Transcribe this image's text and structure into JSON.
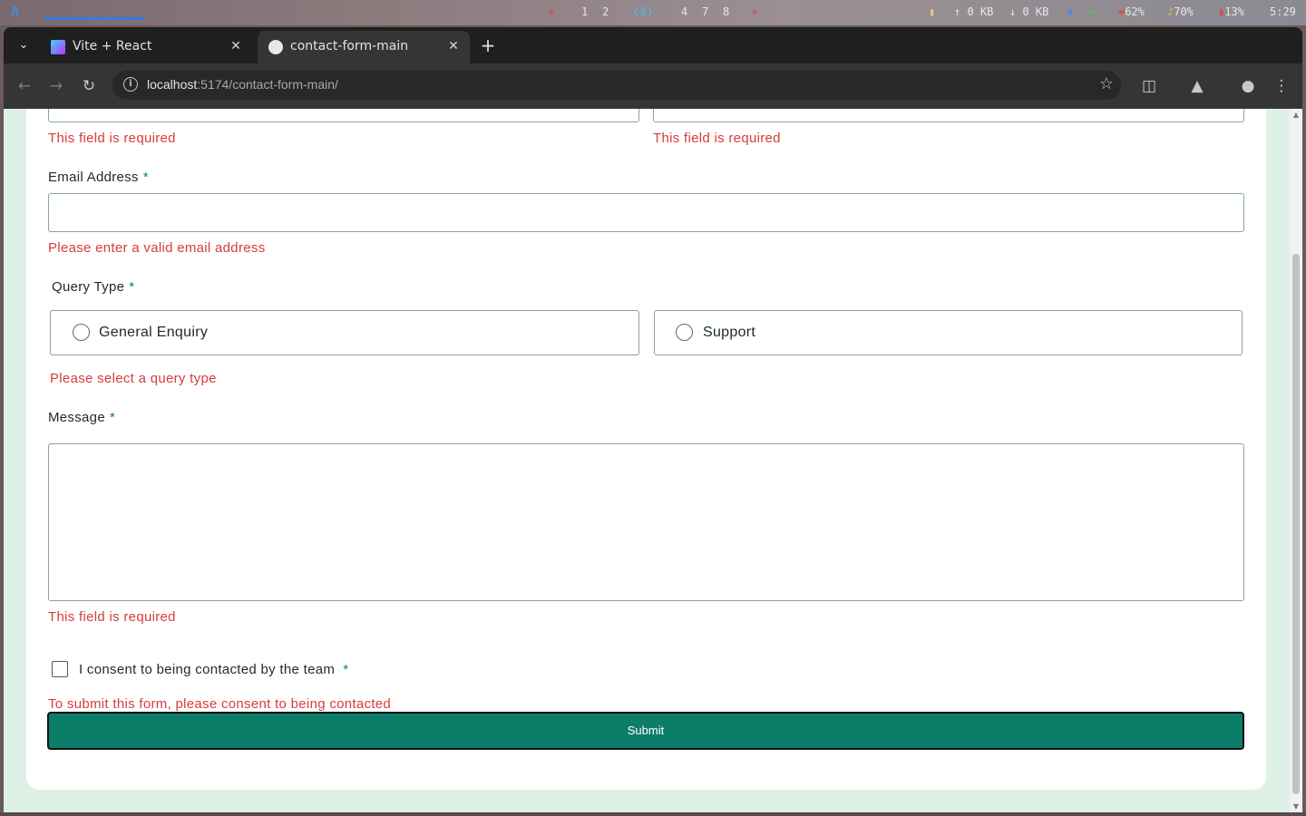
{
  "os_bar": {
    "workspaces": [
      "1",
      "2",
      "3",
      "4",
      "7",
      "8"
    ],
    "active_workspace": "3",
    "upload": "0 KB",
    "download": "0 KB",
    "brightness": "62%",
    "volume": "70%",
    "battery": "13%",
    "time": "5:29"
  },
  "browser": {
    "tabs": [
      {
        "title": "Vite + React",
        "active": false
      },
      {
        "title": "contact-form-main",
        "active": true
      }
    ],
    "url_host": "localhost",
    "url_path": ":5174/contact-form-main/"
  },
  "form": {
    "name_error_1": "This field is required",
    "name_error_2": "This field is required",
    "email_label": "Email Address",
    "email_value": "",
    "email_error": "Please enter a valid email address",
    "query_label": "Query Type",
    "query_options": [
      "General Enquiry",
      "Support"
    ],
    "query_error": "Please select a query type",
    "message_label": "Message",
    "message_value": "",
    "message_error": "This field is required",
    "consent_label": "I consent to being contacted by the team",
    "consent_error": "To submit this form, please consent to being contacted",
    "required_marker": "*",
    "submit_label": "Submit"
  },
  "colors": {
    "accent": "#0c7d69",
    "error": "#d73c3c",
    "page_bg": "#dff0e6"
  }
}
